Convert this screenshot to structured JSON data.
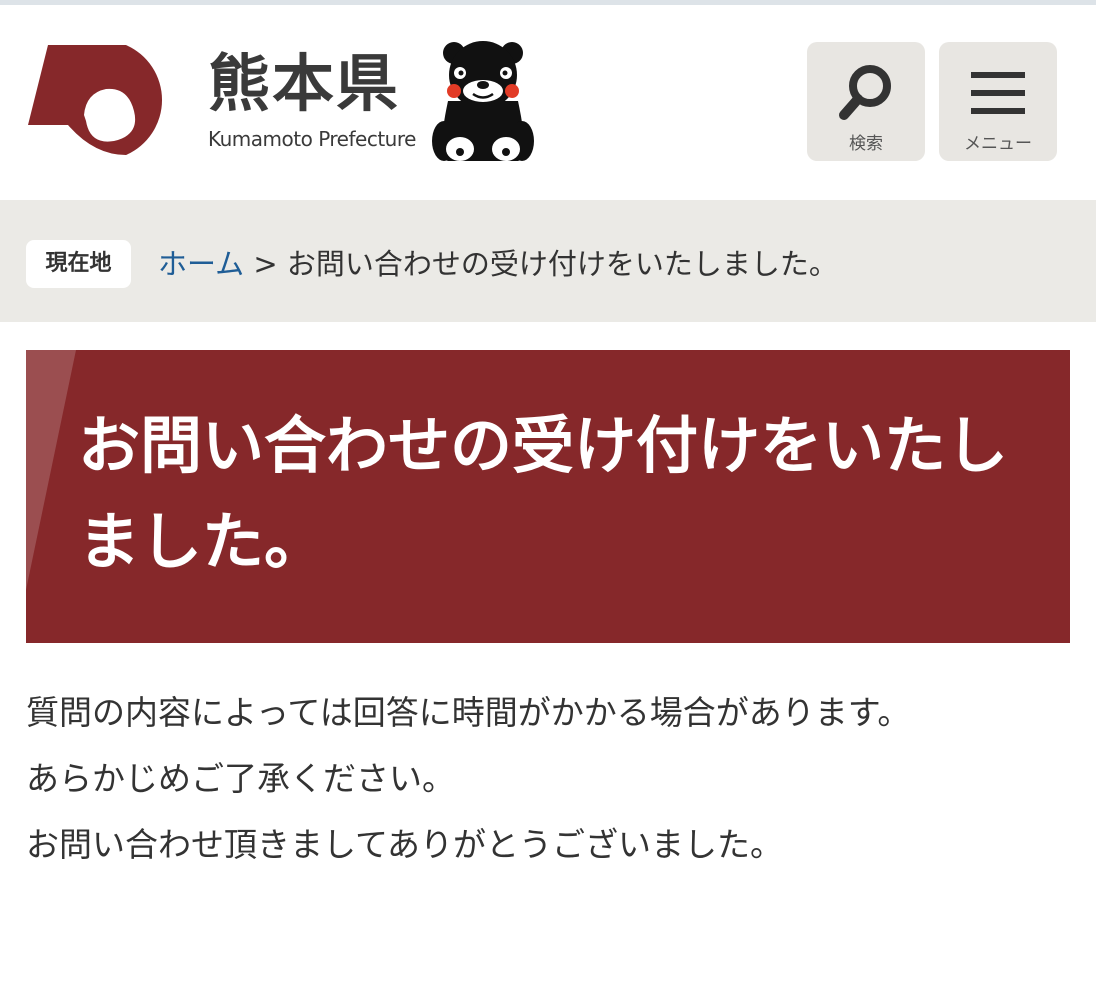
{
  "header": {
    "site_title_jp": "熊本県",
    "site_title_en": "Kumamoto Prefecture",
    "search_label": "検索",
    "menu_label": "メニュー"
  },
  "breadcrumb": {
    "badge": "現在地",
    "home": "ホーム",
    "separator": ">",
    "current": "お問い合わせの受け付けをいたしました。"
  },
  "page": {
    "heading": "お問い合わせの受け付けをいたしました。",
    "paragraphs": [
      "質問の内容によっては回答に時間がかかる場合があります。",
      "あらかじめご了承ください。",
      "お問い合わせ頂きましてありがとうございました。"
    ]
  },
  "colors": {
    "brand_red": "#86282a",
    "breadcrumb_bg": "#ebeae6",
    "link_blue": "#1f5d96",
    "button_bg": "#e8e6e2"
  },
  "icons": {
    "emblem": "kumamoto-emblem-icon",
    "mascot": "kumamon-mascot-icon",
    "search": "search-icon",
    "menu": "hamburger-menu-icon"
  }
}
